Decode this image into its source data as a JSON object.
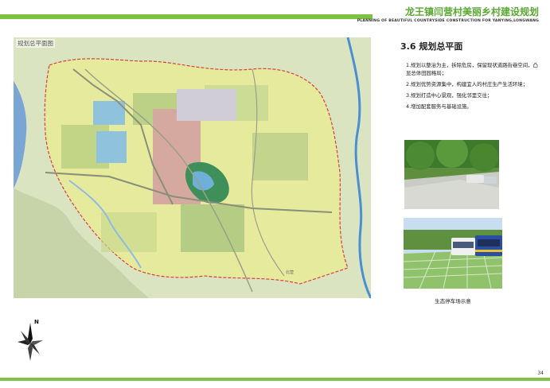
{
  "header": {
    "title": "龙王镇闫营村美丽乡村建设规划",
    "subtitle": "PLANNING OF BEAUTIFUL COUNTRYSIDE CONSTRUCTION FOR YANYING,LONGWANG"
  },
  "map": {
    "label": "规划总平面图",
    "place_label": "北营"
  },
  "section": {
    "title": "3.6 规划总平面",
    "points": [
      "1.规划以整治为主，拆除危房，保留现状道路街巷空间，凸显总体田园格局；",
      "2.规划优势资源集中，构建宜人的村庄生产生活环境；",
      "3.规划打造中心景观，强化邻里交往；",
      "4.增加配套服务与基础设施。"
    ]
  },
  "photos": {
    "caption": "生态停车场示意"
  },
  "compass": {
    "north": "N"
  },
  "footer": {
    "page_number": "34"
  }
}
